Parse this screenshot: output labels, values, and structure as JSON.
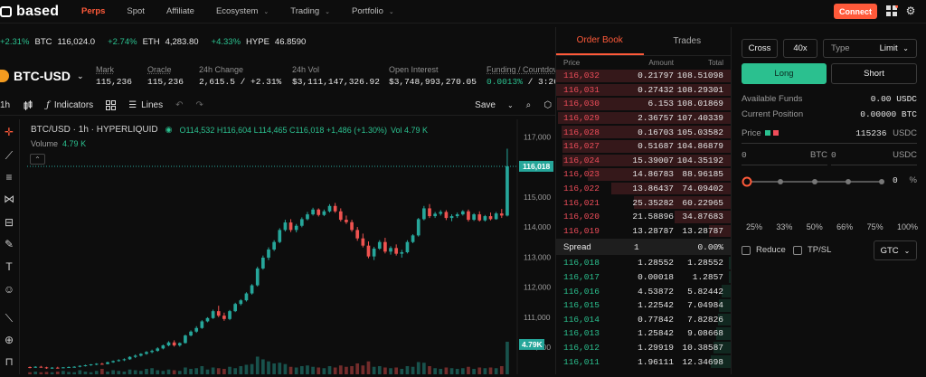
{
  "topbar": {
    "logo": "based",
    "nav": [
      {
        "label": "Perps",
        "active": true,
        "dropdown": false
      },
      {
        "label": "Spot",
        "active": false,
        "dropdown": false
      },
      {
        "label": "Affiliate",
        "active": false,
        "dropdown": false
      },
      {
        "label": "Ecosystem",
        "active": false,
        "dropdown": true
      },
      {
        "label": "Trading",
        "active": false,
        "dropdown": true
      },
      {
        "label": "Portfolio",
        "active": false,
        "dropdown": true
      }
    ],
    "connect_label": "Connect",
    "icons": [
      "grid-icon",
      "settings-icon"
    ]
  },
  "ticker": [
    {
      "change": "+2.31%",
      "symbol": "BTC",
      "price": "116,024.0"
    },
    {
      "change": "+2.74%",
      "symbol": "ETH",
      "price": "4,283.80"
    },
    {
      "change": "+4.33%",
      "symbol": "HYPE",
      "price": "46.8590"
    }
  ],
  "market": {
    "pair": "BTC-USD",
    "mark_label": "Mark",
    "mark": "115,236",
    "oracle_label": "Oracle",
    "oracle": "115,236",
    "change_label": "24h Change",
    "change": "2,615.5 / +2.31%",
    "vol_label": "24h Vol",
    "vol": "$3,111,147,326.92",
    "oi_label": "Open Interest",
    "oi": "$3,748,993,270.05",
    "funding_label": "Funding / Countdow",
    "funding": "0.0013%",
    "countdown": "/ 3:26"
  },
  "chart_toolbar": {
    "interval": "1h",
    "indicators": "Indicators",
    "lines": "Lines",
    "save": "Save"
  },
  "chart_data": {
    "type": "candlestick",
    "legend": "BTC/USD · 1h · HYPERLIQUID",
    "ohlc_text": "O114,532 H116,604 L114,465 C116,018 +1,486 (+1.30%)",
    "vol_text": "Vol 4.79 K",
    "volume_label": "Volume",
    "volume_value": "4.79 K",
    "y_ticks": [
      "117,000",
      "116,000",
      "115,000",
      "114,000",
      "113,000",
      "112,000",
      "111,000",
      "110,000"
    ],
    "ylim": [
      109100,
      117400
    ],
    "last_price": "116,018",
    "last_price_value": 116018,
    "last_volume": "4.79 K",
    "up_color": "#26a69a",
    "down_color": "#ef5350",
    "candles": [
      [
        109340,
        109360,
        109300,
        109330
      ],
      [
        109330,
        109370,
        109310,
        109350
      ],
      [
        109350,
        109380,
        109320,
        109330
      ],
      [
        109330,
        109350,
        109280,
        109300
      ],
      [
        109300,
        109340,
        109280,
        109320
      ],
      [
        109320,
        109350,
        109290,
        109310
      ],
      [
        109310,
        109340,
        109300,
        109330
      ],
      [
        109330,
        109360,
        109310,
        109340
      ],
      [
        109340,
        109370,
        109320,
        109350
      ],
      [
        109350,
        109400,
        109330,
        109380
      ],
      [
        109380,
        109420,
        109360,
        109400
      ],
      [
        109400,
        109440,
        109380,
        109430
      ],
      [
        109430,
        109470,
        109400,
        109450
      ],
      [
        109450,
        109480,
        109420,
        109440
      ],
      [
        109440,
        109520,
        109430,
        109500
      ],
      [
        109500,
        109560,
        109480,
        109540
      ],
      [
        109540,
        109600,
        109520,
        109570
      ],
      [
        109570,
        109630,
        109540,
        109600
      ],
      [
        109600,
        109700,
        109580,
        109680
      ],
      [
        109680,
        109760,
        109640,
        109720
      ],
      [
        109720,
        109800,
        109690,
        109780
      ],
      [
        109780,
        109870,
        109750,
        109840
      ],
      [
        109840,
        109920,
        109800,
        109880
      ],
      [
        109880,
        110000,
        109850,
        109960
      ],
      [
        109960,
        110090,
        109930,
        110060
      ],
      [
        110060,
        110200,
        110030,
        110160
      ],
      [
        110160,
        110230,
        110020,
        110060
      ],
      [
        110060,
        110160,
        110020,
        110140
      ],
      [
        110140,
        110420,
        110120,
        110390
      ],
      [
        110390,
        110560,
        110360,
        110520
      ],
      [
        110520,
        110700,
        110480,
        110640
      ],
      [
        110640,
        110900,
        110610,
        110860
      ],
      [
        110860,
        111000,
        110830,
        110970
      ],
      [
        110970,
        111250,
        110940,
        111200
      ],
      [
        111200,
        111380,
        111000,
        111050
      ],
      [
        111050,
        111150,
        110880,
        110940
      ],
      [
        110940,
        111240,
        110900,
        111200
      ],
      [
        111200,
        111480,
        111170,
        111440
      ],
      [
        111440,
        111600,
        111390,
        111560
      ],
      [
        111560,
        111830,
        111520,
        111790
      ],
      [
        111790,
        112100,
        111750,
        112060
      ],
      [
        112060,
        112680,
        112020,
        112620
      ],
      [
        112620,
        113050,
        112580,
        112980
      ],
      [
        112980,
        113320,
        112900,
        113250
      ],
      [
        113250,
        113560,
        113200,
        113500
      ],
      [
        113500,
        113960,
        113460,
        113900
      ],
      [
        113900,
        114240,
        113850,
        114150
      ],
      [
        114150,
        114260,
        113830,
        113900
      ],
      [
        113900,
        114100,
        113820,
        114040
      ],
      [
        114040,
        114320,
        113990,
        114260
      ],
      [
        114260,
        114500,
        114220,
        114420
      ],
      [
        114420,
        114640,
        114380,
        114580
      ],
      [
        114580,
        114620,
        114350,
        114400
      ],
      [
        114400,
        114580,
        114360,
        114520
      ],
      [
        114520,
        114760,
        114480,
        114700
      ],
      [
        114700,
        114800,
        114470,
        114520
      ],
      [
        114520,
        114620,
        114180,
        114240
      ],
      [
        114240,
        114380,
        114100,
        114160
      ],
      [
        114160,
        114240,
        113840,
        113900
      ],
      [
        113900,
        114000,
        113540,
        113620
      ],
      [
        113620,
        113780,
        113320,
        113380
      ],
      [
        113380,
        113520,
        112960,
        113020
      ],
      [
        113020,
        113340,
        112900,
        113280
      ],
      [
        113280,
        113560,
        113240,
        113500
      ],
      [
        113500,
        113640,
        113120,
        113180
      ],
      [
        113180,
        113360,
        113080,
        113300
      ],
      [
        113300,
        113420,
        113050,
        113110
      ],
      [
        113110,
        113240,
        112980,
        113160
      ],
      [
        113160,
        113560,
        113120,
        113500
      ],
      [
        113500,
        113760,
        113460,
        113720
      ],
      [
        113720,
        114300,
        113680,
        114260
      ],
      [
        114260,
        114700,
        114220,
        114620
      ],
      [
        114620,
        114760,
        114300,
        114360
      ],
      [
        114360,
        114500,
        114300,
        114440
      ],
      [
        114440,
        114560,
        114380,
        114500
      ],
      [
        114500,
        114560,
        114230,
        114300
      ],
      [
        114300,
        114420,
        114190,
        114360
      ],
      [
        114360,
        114480,
        114300,
        114420
      ],
      [
        114420,
        114560,
        114380,
        114520
      ],
      [
        114520,
        114580,
        114180,
        114240
      ],
      [
        114240,
        114460,
        114200,
        114420
      ],
      [
        114420,
        114520,
        114180,
        114220
      ],
      [
        114220,
        114400,
        114180,
        114360
      ],
      [
        114360,
        114480,
        114220,
        114260
      ],
      [
        114260,
        114500,
        114240,
        114450
      ],
      [
        114450,
        114600,
        114300,
        114380
      ],
      [
        114380,
        116604,
        114350,
        116018
      ]
    ],
    "volumes": [
      0.3,
      0.4,
      0.3,
      0.35,
      0.3,
      0.4,
      0.5,
      0.35,
      0.3,
      0.6,
      0.4,
      0.3,
      0.5,
      0.8,
      0.4,
      0.6,
      0.5,
      0.4,
      0.7,
      0.6,
      0.5,
      0.8,
      0.9,
      0.6,
      0.5,
      0.7,
      0.6,
      0.5,
      1.0,
      0.8,
      0.9,
      1.2,
      0.7,
      1.0,
      0.9,
      0.8,
      1.1,
      0.9,
      1.2,
      1.4,
      1.5,
      2.6,
      2.2,
      1.9,
      1.6,
      1.7,
      1.5,
      1.1,
      1.0,
      1.2,
      1.3,
      1.1,
      1.0,
      0.9,
      1.2,
      1.0,
      1.3,
      1.1,
      1.2,
      1.6,
      1.3,
      1.9,
      1.1,
      1.2,
      1.0,
      0.9,
      1.0,
      0.8,
      1.2,
      1.1,
      1.8,
      1.7,
      1.2,
      0.9,
      0.8,
      1.0,
      0.9,
      0.8,
      0.9,
      1.1,
      0.8,
      1.0,
      0.9,
      1.0,
      0.9,
      1.2,
      4.79
    ]
  },
  "orderbook": {
    "tab_book": "Order Book",
    "tab_trades": "Trades",
    "col_price": "Price",
    "col_amount": "Amount",
    "col_total": "Total",
    "asks": [
      {
        "price": "116,032",
        "amount": "0.21797",
        "total": "108.51098",
        "depth": 1.0
      },
      {
        "price": "116,031",
        "amount": "0.27432",
        "total": "108.29301",
        "depth": 0.998
      },
      {
        "price": "116,030",
        "amount": "6.153",
        "total": "108.01869",
        "depth": 0.995
      },
      {
        "price": "116,029",
        "amount": "2.36757",
        "total": "107.40339",
        "depth": 0.99
      },
      {
        "price": "116,028",
        "amount": "0.16703",
        "total": "105.03582",
        "depth": 0.968
      },
      {
        "price": "116,027",
        "amount": "0.51687",
        "total": "104.86879",
        "depth": 0.966
      },
      {
        "price": "116,024",
        "amount": "15.39007",
        "total": "104.35192",
        "depth": 0.962
      },
      {
        "price": "116,023",
        "amount": "14.86783",
        "total": "88.96185",
        "depth": 0.82
      },
      {
        "price": "116,022",
        "amount": "13.86437",
        "total": "74.09402",
        "depth": 0.683
      },
      {
        "price": "116,021",
        "amount": "25.35282",
        "total": "60.22965",
        "depth": 0.555
      },
      {
        "price": "116,020",
        "amount": "21.58896",
        "total": "34.87683",
        "depth": 0.321
      },
      {
        "price": "116,019",
        "amount": "13.28787",
        "total": "13.28787",
        "depth": 0.122
      }
    ],
    "spread_label": "Spread",
    "spread_value": "1",
    "spread_pct": "0.00%",
    "bids": [
      {
        "price": "116,018",
        "amount": "1.28552",
        "total": "1.28552",
        "depth": 0.012
      },
      {
        "price": "116,017",
        "amount": "0.00018",
        "total": "1.2857",
        "depth": 0.012
      },
      {
        "price": "116,016",
        "amount": "4.53872",
        "total": "5.82442",
        "depth": 0.054
      },
      {
        "price": "116,015",
        "amount": "1.22542",
        "total": "7.04984",
        "depth": 0.065
      },
      {
        "price": "116,014",
        "amount": "0.77842",
        "total": "7.82826",
        "depth": 0.072
      },
      {
        "price": "116,013",
        "amount": "1.25842",
        "total": "9.08668",
        "depth": 0.084
      },
      {
        "price": "116,012",
        "amount": "1.29919",
        "total": "10.38587",
        "depth": 0.096
      },
      {
        "price": "116,011",
        "amount": "1.96111",
        "total": "12.34698",
        "depth": 0.114
      }
    ]
  },
  "trade": {
    "margin_mode": "Cross",
    "leverage": "40x",
    "type_label": "Type",
    "type_value": "Limit",
    "long_label": "Long",
    "short_label": "Short",
    "available_label": "Available Funds",
    "available_value": "0.00 USDC",
    "position_label": "Current Position",
    "position_value": "0.00000 BTC",
    "price_label": "Price",
    "price_value": "115236",
    "price_unit": "USDC",
    "size_btc_value": "0",
    "size_btc_unit": "BTC",
    "size_usdc_value": "0",
    "size_usdc_unit": "USDC",
    "slider_value": "0",
    "slider_unit": "%",
    "slider_fraction": 0,
    "percents": [
      "25%",
      "33%",
      "50%",
      "66%",
      "75%",
      "100%"
    ],
    "reduce_label": "Reduce",
    "tpsl_label": "TP/SL",
    "tif_value": "GTC"
  }
}
